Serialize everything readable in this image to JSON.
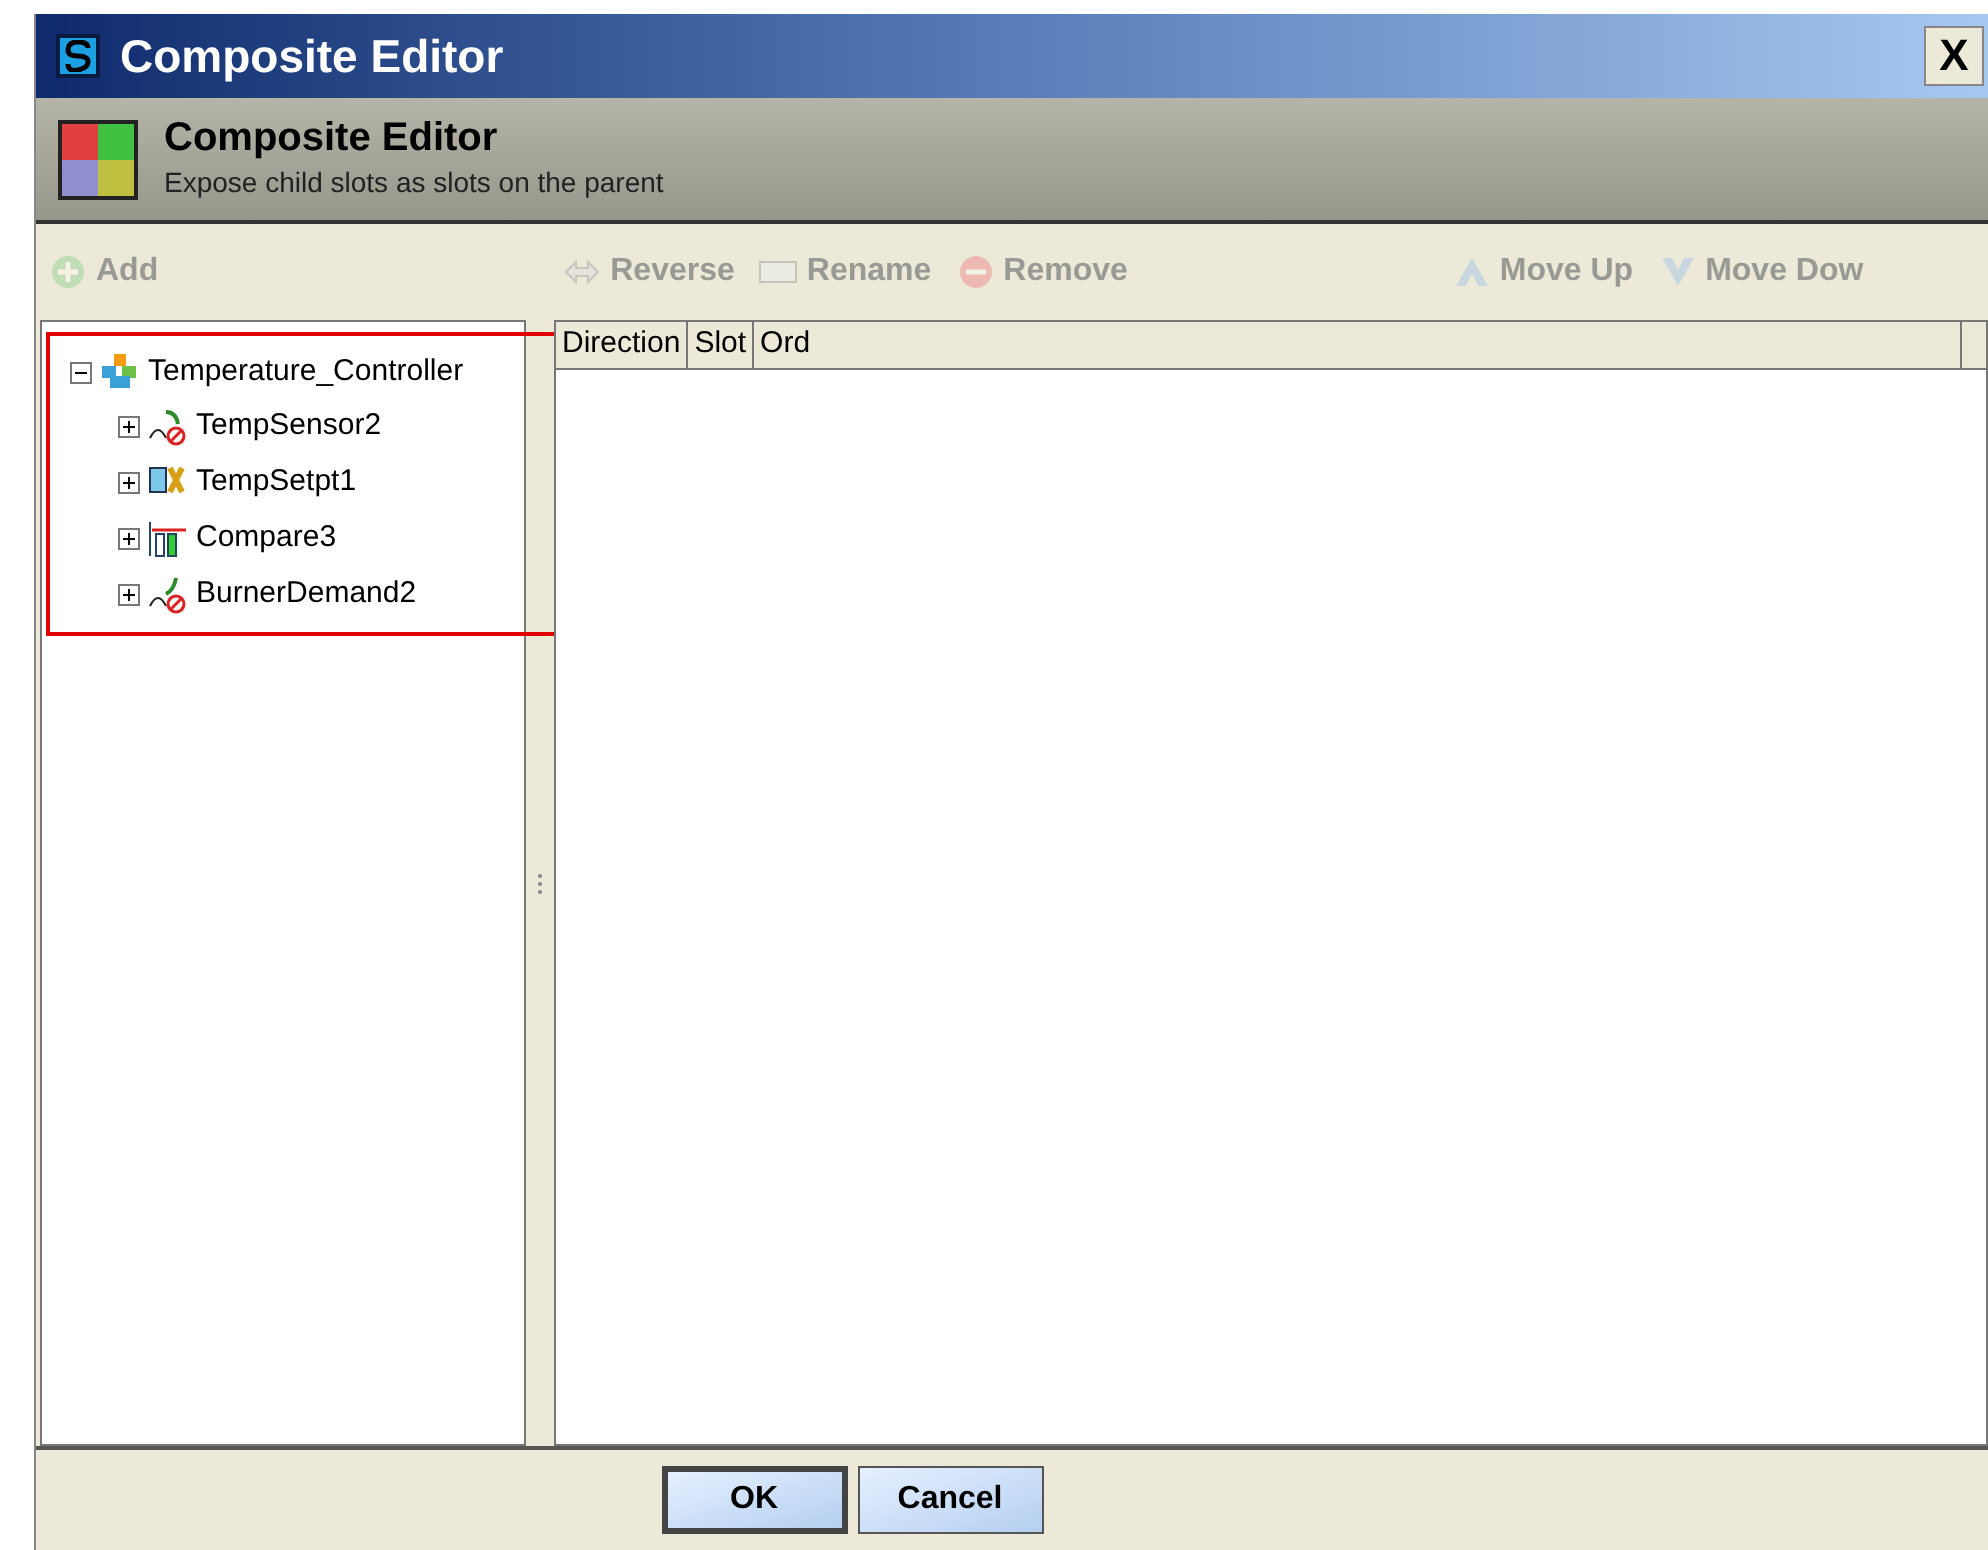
{
  "window": {
    "title": "Composite Editor",
    "close_label": "X"
  },
  "header": {
    "title": "Composite Editor",
    "subtitle": "Expose child slots as slots on the parent"
  },
  "toolbar": [
    {
      "kind": "add",
      "label": "Add",
      "disabled": true
    },
    {
      "kind": "reverse",
      "label": "Reverse",
      "disabled": true
    },
    {
      "kind": "rename",
      "label": "Rename",
      "disabled": true
    },
    {
      "kind": "remove",
      "label": "Remove",
      "disabled": true
    },
    {
      "kind": "up",
      "label": "Move Up",
      "disabled": true
    },
    {
      "kind": "down",
      "label": "Move Dow",
      "disabled": true
    }
  ],
  "tree": {
    "highlighted": true,
    "root": {
      "label": "Temperature_Controller",
      "kind": "composite",
      "expanded": true,
      "children": [
        {
          "label": "TempSensor2",
          "kind": "sensor",
          "expanded": false
        },
        {
          "label": "TempSetpt1",
          "kind": "setpoint",
          "expanded": false
        },
        {
          "label": "Compare3",
          "kind": "compare",
          "expanded": false
        },
        {
          "label": "BurnerDemand2",
          "kind": "demand",
          "expanded": false
        }
      ]
    }
  },
  "table": {
    "columns": [
      "Direction",
      "Slot",
      "Ord"
    ]
  },
  "buttons": [
    {
      "label": "OK",
      "default": true
    },
    {
      "label": "Cancel",
      "default": false
    }
  ]
}
